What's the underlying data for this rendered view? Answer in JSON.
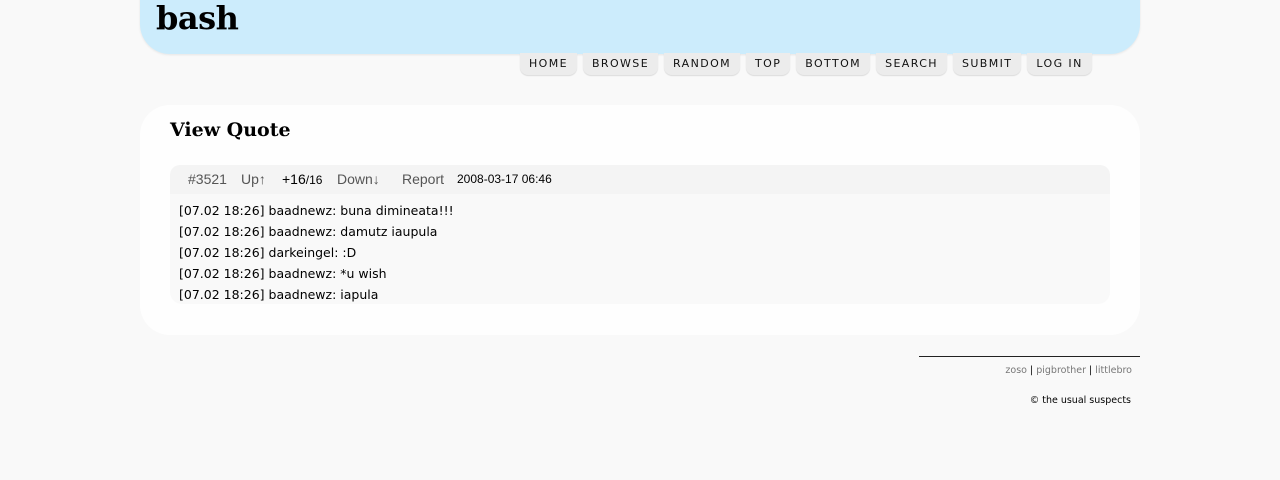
{
  "header": {
    "logo": "bash"
  },
  "nav": {
    "items": [
      "HOME",
      "BROWSE",
      "RANDOM",
      "TOP",
      "BOTTOM",
      "SEARCH",
      "SUBMIT",
      "LOG IN"
    ]
  },
  "page": {
    "title": "View Quote"
  },
  "quote": {
    "id": "#3521",
    "up_label": "Up↑",
    "score": "+16",
    "score_sep": "/",
    "score_total": "16",
    "down_label": "Down↓",
    "report_label": "Report",
    "date": "2008-03-17 06:46",
    "lines": [
      "[07.02 18:26] baadnewz: buna dimineata!!!",
      "[07.02 18:26] baadnewz: damutz iaupula",
      "[07.02 18:26] darkeingel: :D",
      "[07.02 18:26] baadnewz: *u wish",
      "[07.02 18:26] baadnewz: iapula"
    ]
  },
  "footer": {
    "links": [
      "zoso",
      "pigbrother",
      "littlebro"
    ],
    "separator": " | ",
    "copyright": "© the usual suspects"
  },
  "colors": {
    "header_bg": "#ccecfc",
    "page_bg": "#f9f9f9",
    "link_gray": "#777777"
  }
}
